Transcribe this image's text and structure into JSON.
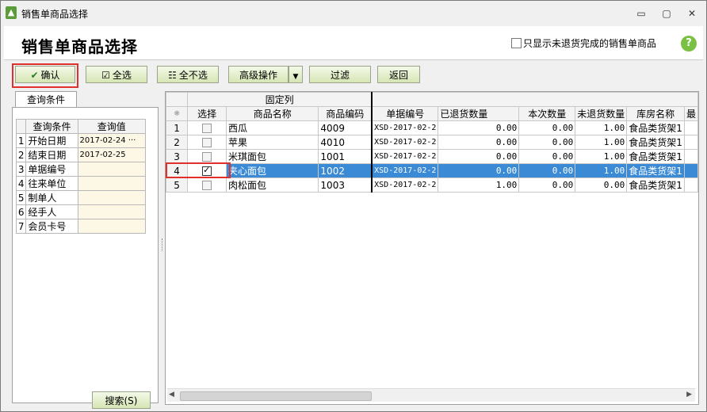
{
  "window": {
    "title": "销售单商品选择",
    "min": "▭",
    "max": "▢",
    "close": "✕"
  },
  "header": {
    "title": "销售单商品选择",
    "only_unreturned_label": "只显示未退货完成的销售单商品",
    "help": "?"
  },
  "toolbar": {
    "confirm": "确认",
    "select_all": "全选",
    "select_none": "全不选",
    "advanced": "高级操作",
    "filter": "过滤",
    "back": "返回"
  },
  "query": {
    "tab": "查询条件",
    "col_condition": "查询条件",
    "col_value": "查询值",
    "rows": [
      {
        "n": "1",
        "label": "开始日期",
        "value": "2017-02-24",
        "more": "···"
      },
      {
        "n": "2",
        "label": "结束日期",
        "value": "2017-02-25",
        "more": ""
      },
      {
        "n": "3",
        "label": "单据编号",
        "value": "",
        "more": ""
      },
      {
        "n": "4",
        "label": "往来单位",
        "value": "",
        "more": ""
      },
      {
        "n": "5",
        "label": "制单人",
        "value": "",
        "more": ""
      },
      {
        "n": "6",
        "label": "经手人",
        "value": "",
        "more": ""
      },
      {
        "n": "7",
        "label": "会员卡号",
        "value": "",
        "more": ""
      }
    ],
    "search_button": "搜索(S)"
  },
  "grid": {
    "band_label": "固定列",
    "corner": "❋",
    "headers": [
      "选择",
      "商品名称",
      "商品编码",
      "单据编号",
      "已退货数量",
      "本次数量",
      "未退货数量",
      "库房名称",
      "最"
    ],
    "rows": [
      {
        "n": "1",
        "checked": false,
        "name": "西瓜",
        "code": "4009",
        "bill": "XSD-2017-02-2",
        "returned": "0.00",
        "current": "0.00",
        "unreturned": "1.00",
        "store": "食品类货架1"
      },
      {
        "n": "2",
        "checked": false,
        "name": "苹果",
        "code": "4010",
        "bill": "XSD-2017-02-2",
        "returned": "0.00",
        "current": "0.00",
        "unreturned": "1.00",
        "store": "食品类货架1"
      },
      {
        "n": "3",
        "checked": false,
        "name": "米琪面包",
        "code": "1001",
        "bill": "XSD-2017-02-2",
        "returned": "0.00",
        "current": "0.00",
        "unreturned": "1.00",
        "store": "食品类货架1"
      },
      {
        "n": "4",
        "checked": true,
        "name": "夹心面包",
        "code": "1002",
        "bill": "XSD-2017-02-2",
        "returned": "0.00",
        "current": "0.00",
        "unreturned": "1.00",
        "store": "食品类货架1"
      },
      {
        "n": "5",
        "checked": false,
        "name": "肉松面包",
        "code": "1003",
        "bill": "XSD-2017-02-2",
        "returned": "1.00",
        "current": "0.00",
        "unreturned": "0.00",
        "store": "食品类货架1"
      }
    ],
    "selected_row": 3
  },
  "colors": {
    "accent": "#e0302b",
    "selection": "#3b8ad6",
    "button_green": "#d6e6b4"
  }
}
